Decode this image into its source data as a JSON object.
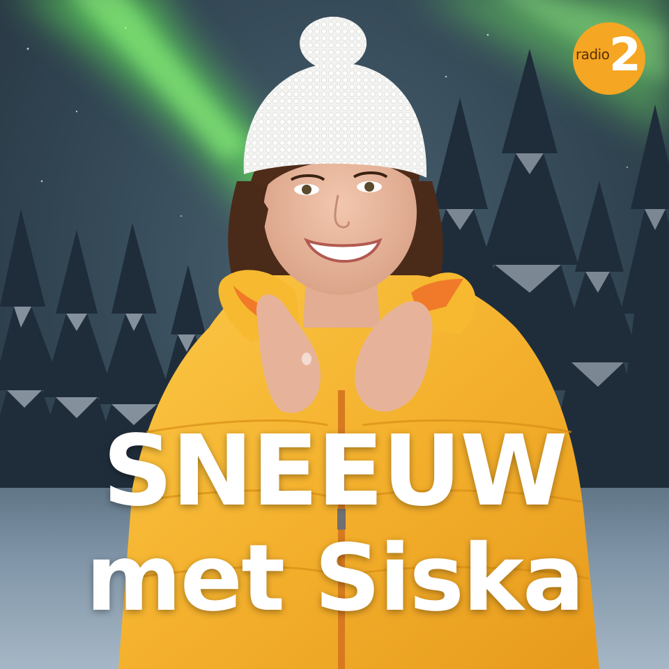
{
  "title": {
    "line1": "SNEEUW",
    "line2": "met Siska"
  },
  "logo": {
    "word": "radio",
    "number": "2",
    "color": "#f5a623"
  },
  "colors": {
    "jacket": "#f7b632",
    "hat": "#f4f4f2",
    "aurora": "#6ee36a",
    "sky": "#334755"
  }
}
